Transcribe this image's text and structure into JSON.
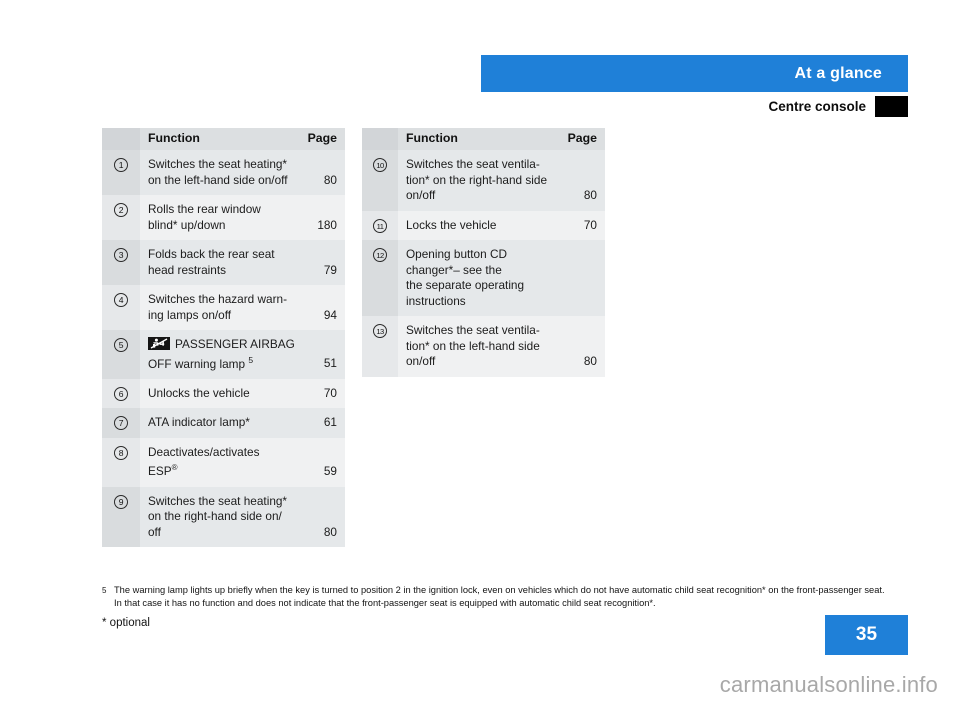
{
  "header": {
    "section_title": "At a glance",
    "page_title": "Centre console",
    "accent_color": "#1f80d8",
    "marker_color": "#000000"
  },
  "tables": [
    {
      "id": "left",
      "columns": {
        "num": "",
        "function": "Function",
        "page": "Page"
      },
      "rows": [
        {
          "num": "1",
          "function": "Switches the seat heating*\non the left-hand side on/off",
          "page": "80"
        },
        {
          "num": "2",
          "function": "Rolls the rear window\nblind* up/down",
          "page": "180"
        },
        {
          "num": "3",
          "function": "Folds back the rear seat\nhead restraints",
          "page": "79"
        },
        {
          "num": "4",
          "function": "Switches the hazard warn-\ning lamps on/off",
          "page": "94"
        },
        {
          "num": "5",
          "function": "PASSENGER AIRBAG\nOFF warning lamp",
          "function_icon": "passenger-airbag-off-icon",
          "footnote_ref": "5",
          "page": "51"
        },
        {
          "num": "6",
          "function": "Unlocks the vehicle",
          "page": "70"
        },
        {
          "num": "7",
          "function": "ATA indicator lamp*",
          "page": "61"
        },
        {
          "num": "8",
          "function": "Deactivates/activates\nESP",
          "registered": true,
          "page": "59"
        },
        {
          "num": "9",
          "function": "Switches the seat heating*\non the right-hand side on/\noff",
          "page": "80"
        }
      ]
    },
    {
      "id": "right",
      "columns": {
        "num": "",
        "function": "Function",
        "page": "Page"
      },
      "rows": [
        {
          "num": "10",
          "function": "Switches the seat ventila-\ntion* on the right-hand side\non/off",
          "page": "80"
        },
        {
          "num": "11",
          "function": "Locks the vehicle",
          "page": "70"
        },
        {
          "num": "12",
          "function": "Opening button CD\nchanger*– see the\nthe separate operating\ninstructions",
          "page": ""
        },
        {
          "num": "13",
          "function": "Switches the seat ventila-\ntion* on the left-hand side\non/off",
          "page": "80"
        }
      ]
    }
  ],
  "footnotes": [
    {
      "mark": "5",
      "text": "The warning lamp lights up briefly when the key is turned to position 2 in the ignition lock, even on vehicles which do not have automatic child seat recognition* on the front-passenger seat. In that case it has no function and does not indicate that the front-passenger seat is equipped with automatic child seat recognition*."
    }
  ],
  "optional_note": "* optional",
  "page_number": "35",
  "watermark": "carmanualsonline.info"
}
